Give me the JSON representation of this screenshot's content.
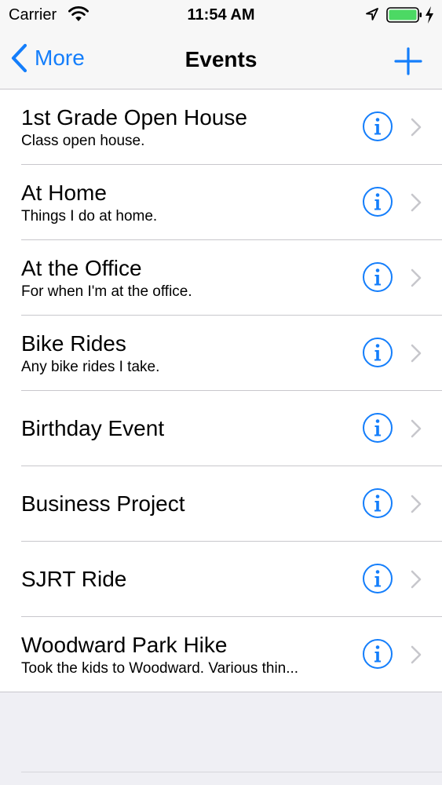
{
  "status_bar": {
    "carrier": "Carrier",
    "time": "11:54 AM",
    "battery_color": "#4cd964"
  },
  "nav": {
    "back_label": "More",
    "title": "Events",
    "accent_color": "#147efb",
    "icons": {
      "back": "chevron-left-icon",
      "add": "plus-icon",
      "info": "info-circle-icon",
      "disclosure": "chevron-right-icon"
    }
  },
  "events": [
    {
      "title": "1st Grade Open House",
      "subtitle": "Class open house."
    },
    {
      "title": "At Home",
      "subtitle": "Things I do at home."
    },
    {
      "title": "At the Office",
      "subtitle": "For when I'm at the office."
    },
    {
      "title": "Bike Rides",
      "subtitle": "Any bike rides I take."
    },
    {
      "title": "Birthday Event",
      "subtitle": ""
    },
    {
      "title": "Business Project",
      "subtitle": ""
    },
    {
      "title": "SJRT Ride",
      "subtitle": ""
    },
    {
      "title": "Woodward Park Hike",
      "subtitle": "Took the kids to Woodward. Various thin..."
    }
  ]
}
